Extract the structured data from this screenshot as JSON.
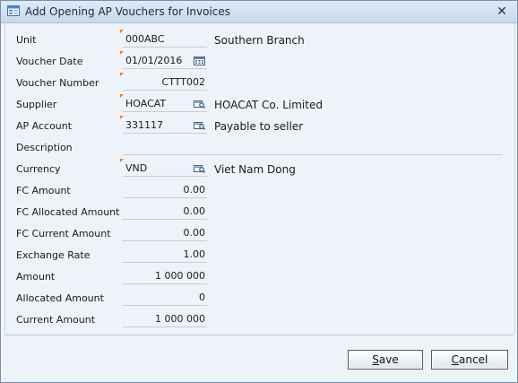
{
  "window": {
    "title": "Add Opening AP Vouchers for Invoices",
    "close_glyph": "✕"
  },
  "form": {
    "unit": {
      "label": "Unit",
      "value": "000ABC",
      "description": "Southern Branch"
    },
    "voucher_date": {
      "label": "Voucher Date",
      "value": "01/01/2016",
      "icon": "calendar-icon"
    },
    "voucher_number": {
      "label": "Voucher Number",
      "value": "CTTT002"
    },
    "supplier": {
      "label": "Supplier",
      "value": "HOACAT",
      "description": "HOACAT Co. Limited",
      "icon": "lookup-icon"
    },
    "ap_account": {
      "label": "AP Account",
      "value": "331117",
      "description": "Payable to seller",
      "icon": "lookup-icon"
    },
    "description": {
      "label": "Description",
      "value": ""
    },
    "currency": {
      "label": "Currency",
      "value": "VND",
      "description": "Viet Nam Dong",
      "icon": "lookup-icon"
    },
    "fc_amount": {
      "label": "FC Amount",
      "value": "0.00"
    },
    "fc_allocated_amount": {
      "label": "FC Allocated Amount",
      "value": "0.00"
    },
    "fc_current_amount": {
      "label": "FC Current Amount",
      "value": "0.00"
    },
    "exchange_rate": {
      "label": "Exchange Rate",
      "value": "1.00"
    },
    "amount": {
      "label": "Amount",
      "value": "1 000 000"
    },
    "allocated_amount": {
      "label": "Allocated Amount",
      "value": "0"
    },
    "current_amount": {
      "label": "Current Amount",
      "value": "1 000 000"
    }
  },
  "buttons": {
    "save": {
      "mnemonic": "S",
      "rest": "ave"
    },
    "cancel": {
      "mnemonic": "C",
      "rest": "ancel"
    }
  },
  "colors": {
    "required_marker": "#ff7a00",
    "window_border": "#7a8ea8",
    "background": "#eef3fa"
  }
}
